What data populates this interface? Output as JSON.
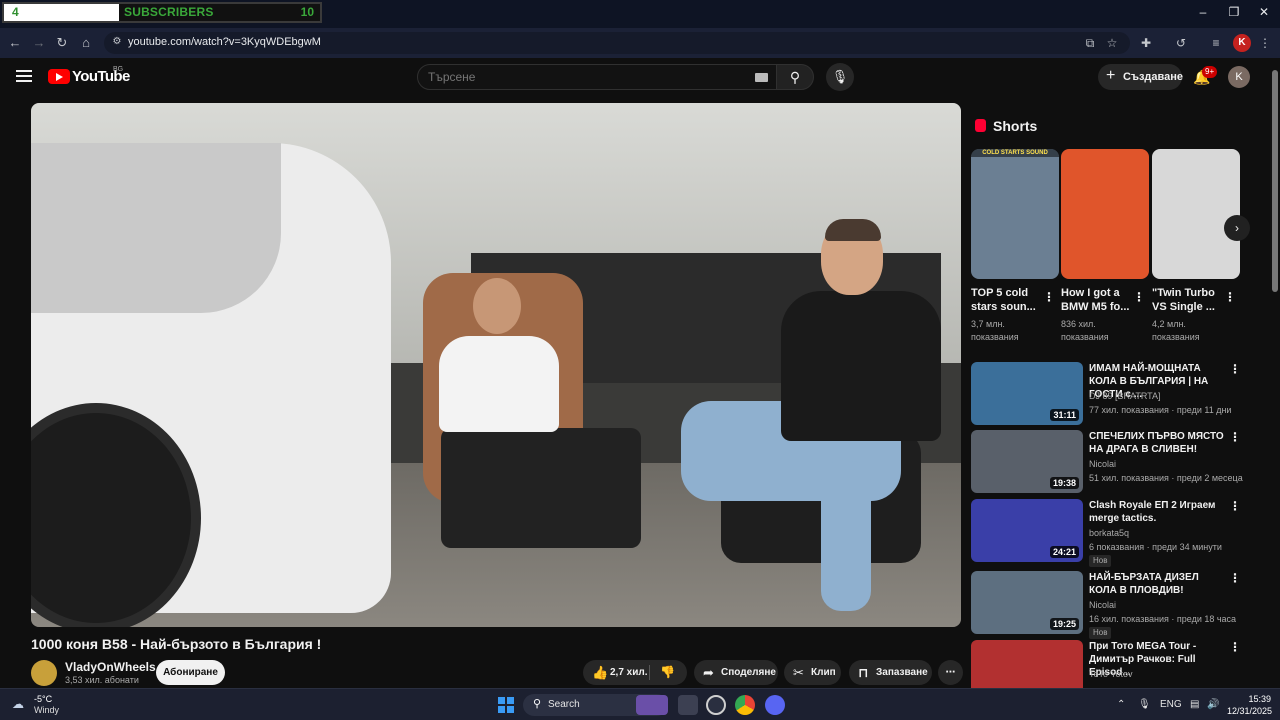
{
  "browser": {
    "sub_widget": {
      "left_count": "4",
      "label": "SUBSCRIBERS",
      "right_count": "10"
    },
    "url": "youtube.com/watch?v=3KyqWDEbgwM",
    "profile_initial": "K"
  },
  "header": {
    "logo_text": "YouTube",
    "region": "BG",
    "search_placeholder": "Търсене",
    "create_label": "Създаване",
    "notifications_badge": "9+",
    "avatar_initial": "K"
  },
  "video": {
    "title": "1000 коня B58 - Най-бързото в България !",
    "channel": "VladyOnWheels",
    "subscribers": "3,53 хил. абонати",
    "subscribe_label": "Абониране",
    "likes": "2,7 хил.",
    "share_label": "Споделяне",
    "clip_label": "Клип",
    "save_label": "Запазване"
  },
  "shorts": {
    "title": "Shorts",
    "items": [
      {
        "title": "TOP 5 cold stars soun...",
        "views": "3,7 млн. показвания",
        "thumb_caption": "COLD STARTS SOUND",
        "color": "#6b7f93"
      },
      {
        "title": "How I got a BMW M5 fo...",
        "views": "836 хил. показвания",
        "color": "#e0552b"
      },
      {
        "title": "\"Twin Turbo VS Single ...",
        "views": "4,2 млн. показвания",
        "color": "#d8d8d8"
      }
    ]
  },
  "recommended": [
    {
      "title": "ИМАМ НАЙ-МОЩНАТА КОЛА В БЪЛГАРИЯ | НА ГОСТИ с ...",
      "channel": "DJ 89 [BRATRTA]",
      "meta": "77 хил. показвания · преди 11 дни",
      "duration": "31:11",
      "badge": "",
      "color": "#3b6f9a"
    },
    {
      "title": "СПЕЧЕЛИХ ПЪРВО МЯСТО НА ДРАГА В СЛИВЕН!",
      "channel": "Nicolai",
      "meta": "51 хил. показвания · преди 2 месеца",
      "duration": "19:38",
      "badge": "",
      "color": "#59606a"
    },
    {
      "title": "Clash Royale ЕП 2 Играем merge tactics.",
      "channel": "borkata5q",
      "meta": "6 показвания · преди 34 минути",
      "duration": "24:21",
      "badge": "Нов",
      "color": "#3a3fa8"
    },
    {
      "title": "НАЙ-БЪРЗАТА ДИЗЕЛ КОЛА В ПЛОВДИВ!",
      "channel": "Nicolai",
      "meta": "16 хил. показвания · преди 18 часа",
      "duration": "19:25",
      "badge": "Нов",
      "color": "#5d6f80"
    },
    {
      "title": "При Тото MEGA Tour - Димитър Рачков:  Full Episod...",
      "channel": "ToTo Yotov",
      "meta": "",
      "duration": "",
      "badge": "",
      "color": "#b23030"
    }
  ],
  "taskbar": {
    "temp": "-5°C",
    "weather": "Windy",
    "search": "Search",
    "lang": "ENG",
    "time": "15:39",
    "date": "12/31/2025"
  }
}
